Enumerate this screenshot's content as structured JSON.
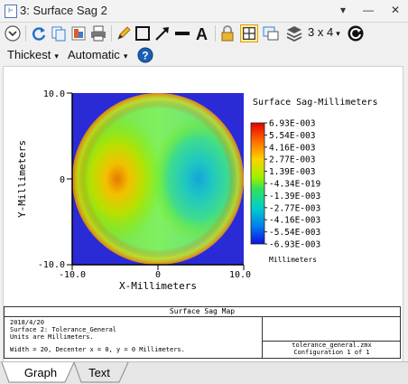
{
  "window": {
    "title": "3: Surface Sag 2"
  },
  "toolbar": {
    "layout_label": "3 x 4"
  },
  "toolbar2": {
    "line_weight": "Thickest",
    "scale_mode": "Automatic"
  },
  "plot": {
    "xlabel": "X-Millimeters",
    "ylabel": "Y-Millimeters",
    "x_ticks": [
      "-10.0",
      "0",
      "10.0"
    ],
    "y_ticks": [
      "10.0",
      "0",
      "-10.0"
    ],
    "legend_title": "Surface Sag-Millimeters",
    "legend_values": [
      "6.93E-003",
      "5.54E-003",
      "4.16E-003",
      "2.77E-003",
      "1.39E-003",
      "-4.34E-019",
      "-1.39E-003",
      "-2.77E-003",
      "-4.16E-003",
      "-5.54E-003",
      "-6.93E-003"
    ],
    "legend_unit": "Millimeters"
  },
  "chart_data": {
    "type": "heatmap",
    "xlabel": "X-Millimeters",
    "ylabel": "Y-Millimeters",
    "xlim": [
      -10,
      10
    ],
    "ylim": [
      -10,
      10
    ],
    "zlim": [
      -0.00693,
      0.00693
    ],
    "aperture_radius": 10,
    "peak": {
      "x": -4.5,
      "y": 0,
      "value": 0.00693
    },
    "trough": {
      "x": 4.5,
      "y": 0,
      "value": -0.00693
    }
  },
  "info_box": {
    "header": "Surface Sag Map",
    "line1": "2018/4/20",
    "line2": "Surface 2: Tolerance_General",
    "line3": "Units are Millimeters.",
    "line4": "Width = 20, Decenter x = 0, y = 0 Millimeters.",
    "file": "tolerance_general.zmx",
    "config": "Configuration 1 of 1"
  },
  "tabs": {
    "graph": "Graph",
    "text": "Text"
  },
  "colors": {
    "accent": "#1a5fb4",
    "plot_bg": "#2a2ad6"
  }
}
